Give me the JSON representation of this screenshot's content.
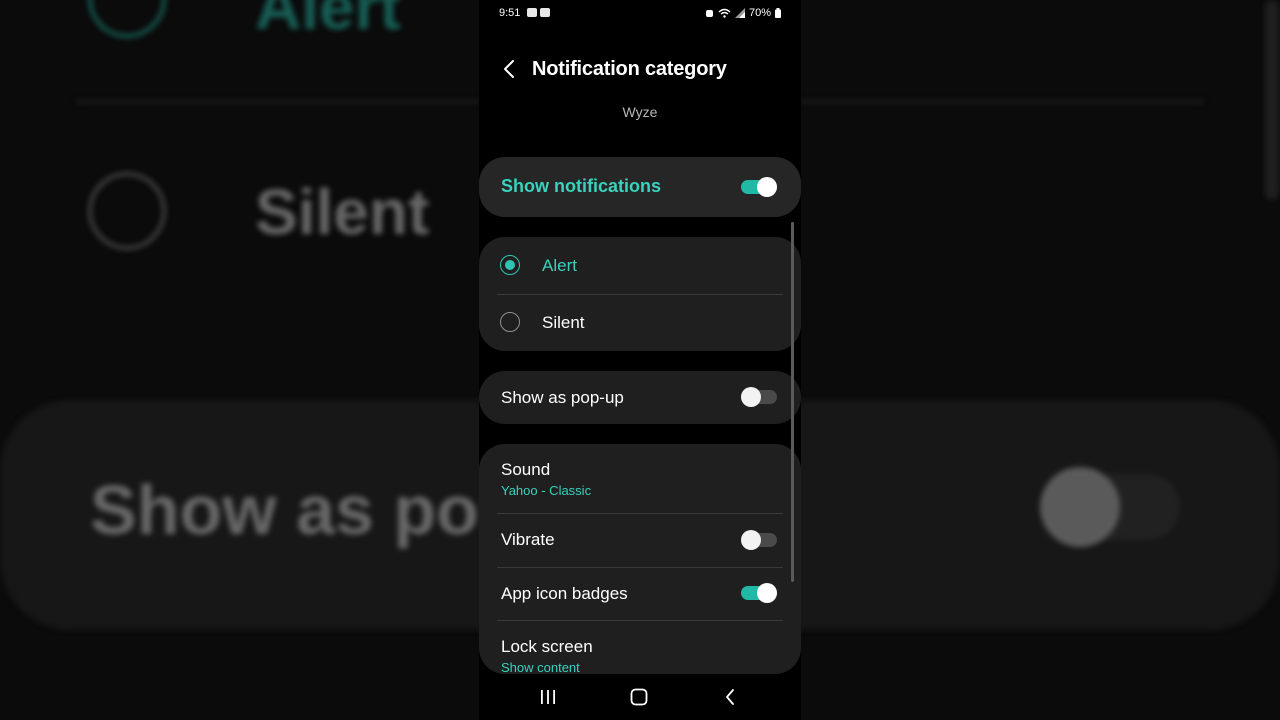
{
  "status_bar": {
    "time": "9:51",
    "battery": "70%"
  },
  "header": {
    "title": "Notification category",
    "back_icon": "chevron-left-icon"
  },
  "app_name": "Wyze",
  "show_notifications": {
    "label": "Show notifications",
    "enabled": true
  },
  "mode_options": [
    {
      "label": "Alert",
      "selected": true
    },
    {
      "label": "Silent",
      "selected": false
    }
  ],
  "show_as_popup": {
    "label": "Show as pop-up",
    "enabled": false
  },
  "settings": {
    "sound": {
      "label": "Sound",
      "value": "Yahoo - Classic"
    },
    "vibrate": {
      "label": "Vibrate",
      "enabled": false
    },
    "app_icon_badges": {
      "label": "App icon badges",
      "enabled": true
    },
    "lock_screen": {
      "label": "Lock screen",
      "value": "Show content"
    }
  },
  "background": {
    "silent_label": "Silent",
    "popup_label_fragment": "Show as pop",
    "alert_label_fragment": "Alert"
  },
  "nav_bar": {
    "recents_icon": "recents-icon",
    "home_icon": "home-icon",
    "back_icon": "back-icon"
  },
  "colors": {
    "accent": "#3ad1bd",
    "toggle_on": "#22b8a6",
    "card": "#1f1f1f",
    "background": "#000000"
  }
}
